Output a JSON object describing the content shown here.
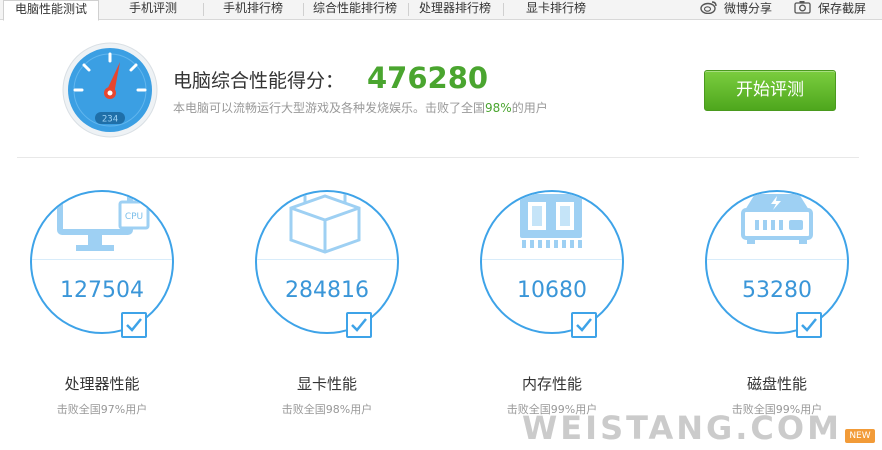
{
  "tabs": [
    {
      "label": "电脑性能测试",
      "active": true
    },
    {
      "label": "手机评测",
      "active": false
    },
    {
      "label": "手机排行榜",
      "active": false
    },
    {
      "label": "综合性能排行榜",
      "active": false
    },
    {
      "label": "处理器排行榜",
      "active": false
    },
    {
      "label": "显卡排行榜",
      "active": false
    }
  ],
  "actions": {
    "weibo_share": "微博分享",
    "save_screenshot": "保存截屏"
  },
  "summary": {
    "title": "电脑综合性能得分：",
    "score": "476280",
    "desc_prefix": "本电脑可以流畅运行大型游戏及各种发烧娱乐。击败了全国",
    "desc_pct": "98%",
    "desc_suffix": "的用户",
    "gauge_readout": "234",
    "start_button": "开始评测"
  },
  "cards": [
    {
      "value": "127504",
      "label": "处理器性能",
      "sub": "击败全国97%用户",
      "icon": "monitor-cpu-icon",
      "icon_text": "CPU"
    },
    {
      "value": "284816",
      "label": "显卡性能",
      "sub": "击败全国98%用户",
      "icon": "cube-icon"
    },
    {
      "value": "10680",
      "label": "内存性能",
      "sub": "击败全国99%用户",
      "icon": "memory-chip-icon"
    },
    {
      "value": "53280",
      "label": "磁盘性能",
      "sub": "击败全国99%用户",
      "icon": "hard-disk-icon"
    }
  ],
  "watermark": "WEISTANG.COM",
  "badge": "NEW",
  "colors": {
    "accent_blue": "#3ea3e8",
    "score_green": "#4aa52f",
    "button_green": "#5cb82a",
    "gauge_needle": "#e8462f"
  }
}
